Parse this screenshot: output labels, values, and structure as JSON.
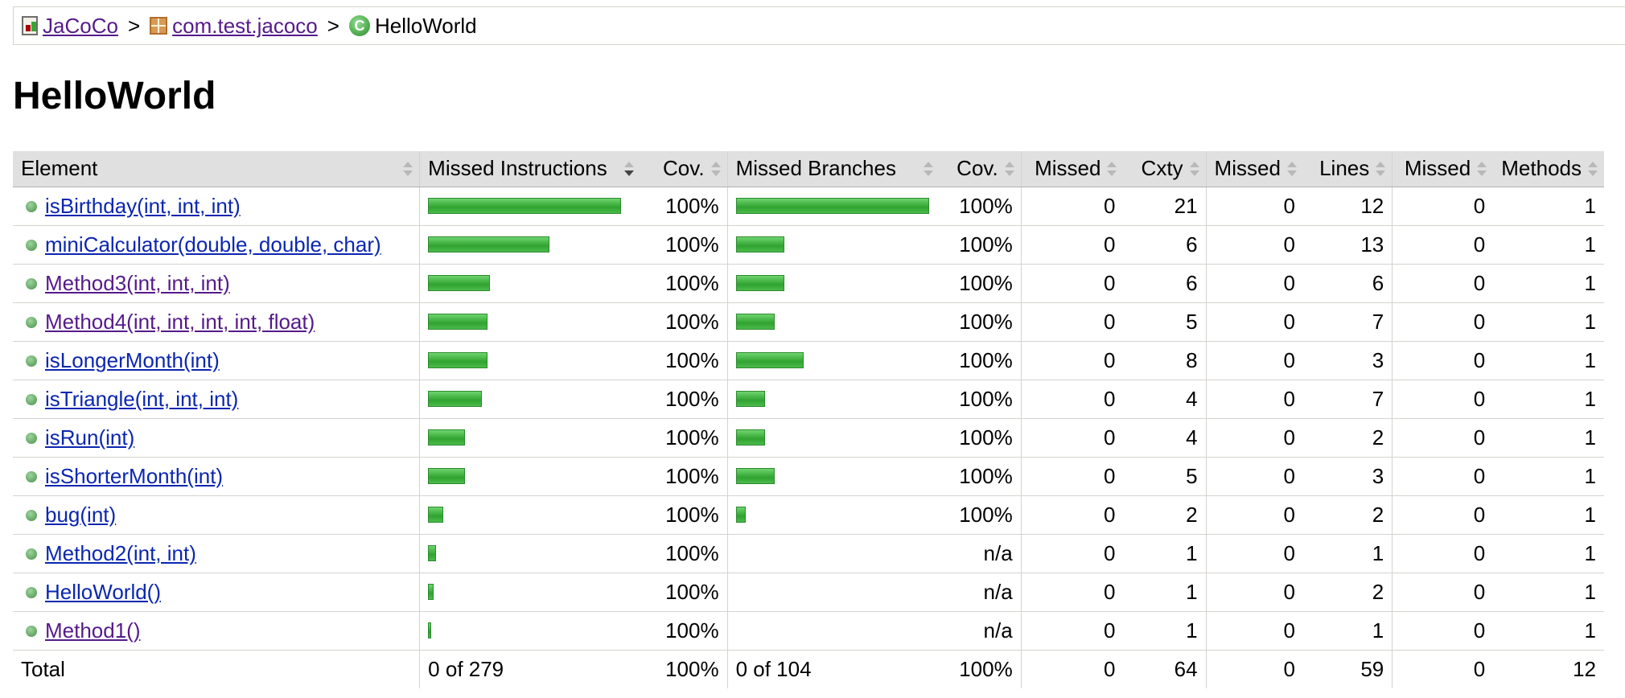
{
  "breadcrumb": {
    "root": "JaCoCo",
    "package": "com.test.jacoco",
    "current": "HelloWorld",
    "separator": ">"
  },
  "page_title": "HelloWorld",
  "table": {
    "headers": {
      "element": "Element",
      "missed_instructions": "Missed Instructions",
      "instr_cov": "Cov.",
      "missed_branches": "Missed Branches",
      "branch_cov": "Cov.",
      "missed_cxty": "Missed",
      "cxty": "Cxty",
      "missed_lines": "Missed",
      "lines": "Lines",
      "missed_methods": "Missed",
      "methods": "Methods"
    },
    "rows": [
      {
        "element": "isBirthday(int, int, int)",
        "visited": false,
        "instr_fill": 1.0,
        "instr_cov": "100%",
        "branch_fill": 1.0,
        "branch_cov": "100%",
        "missed_cxty": "0",
        "cxty": "21",
        "missed_lines": "0",
        "lines": "12",
        "missed_methods": "0",
        "methods": "1"
      },
      {
        "element": "miniCalculator(double, double, char)",
        "visited": false,
        "instr_fill": 0.63,
        "instr_cov": "100%",
        "branch_fill": 0.25,
        "branch_cov": "100%",
        "missed_cxty": "0",
        "cxty": "6",
        "missed_lines": "0",
        "lines": "13",
        "missed_methods": "0",
        "methods": "1"
      },
      {
        "element": "Method3(int, int, int)",
        "visited": true,
        "instr_fill": 0.32,
        "instr_cov": "100%",
        "branch_fill": 0.25,
        "branch_cov": "100%",
        "missed_cxty": "0",
        "cxty": "6",
        "missed_lines": "0",
        "lines": "6",
        "missed_methods": "0",
        "methods": "1"
      },
      {
        "element": "Method4(int, int, int, int, float)",
        "visited": true,
        "instr_fill": 0.31,
        "instr_cov": "100%",
        "branch_fill": 0.2,
        "branch_cov": "100%",
        "missed_cxty": "0",
        "cxty": "5",
        "missed_lines": "0",
        "lines": "7",
        "missed_methods": "0",
        "methods": "1"
      },
      {
        "element": "isLongerMonth(int)",
        "visited": false,
        "instr_fill": 0.31,
        "instr_cov": "100%",
        "branch_fill": 0.35,
        "branch_cov": "100%",
        "missed_cxty": "0",
        "cxty": "8",
        "missed_lines": "0",
        "lines": "3",
        "missed_methods": "0",
        "methods": "1"
      },
      {
        "element": "isTriangle(int, int, int)",
        "visited": false,
        "instr_fill": 0.28,
        "instr_cov": "100%",
        "branch_fill": 0.15,
        "branch_cov": "100%",
        "missed_cxty": "0",
        "cxty": "4",
        "missed_lines": "0",
        "lines": "7",
        "missed_methods": "0",
        "methods": "1"
      },
      {
        "element": "isRun(int)",
        "visited": false,
        "instr_fill": 0.19,
        "instr_cov": "100%",
        "branch_fill": 0.15,
        "branch_cov": "100%",
        "missed_cxty": "0",
        "cxty": "4",
        "missed_lines": "0",
        "lines": "2",
        "missed_methods": "0",
        "methods": "1"
      },
      {
        "element": "isShorterMonth(int)",
        "visited": false,
        "instr_fill": 0.19,
        "instr_cov": "100%",
        "branch_fill": 0.2,
        "branch_cov": "100%",
        "missed_cxty": "0",
        "cxty": "5",
        "missed_lines": "0",
        "lines": "3",
        "missed_methods": "0",
        "methods": "1"
      },
      {
        "element": "bug(int)",
        "visited": false,
        "instr_fill": 0.08,
        "instr_cov": "100%",
        "branch_fill": 0.05,
        "branch_cov": "100%",
        "missed_cxty": "0",
        "cxty": "2",
        "missed_lines": "0",
        "lines": "2",
        "missed_methods": "0",
        "methods": "1"
      },
      {
        "element": "Method2(int, int)",
        "visited": false,
        "instr_fill": 0.04,
        "instr_cov": "100%",
        "branch_fill": 0,
        "branch_cov": "n/a",
        "missed_cxty": "0",
        "cxty": "1",
        "missed_lines": "0",
        "lines": "1",
        "missed_methods": "0",
        "methods": "1"
      },
      {
        "element": "HelloWorld()",
        "visited": false,
        "instr_fill": 0.03,
        "instr_cov": "100%",
        "branch_fill": 0,
        "branch_cov": "n/a",
        "missed_cxty": "0",
        "cxty": "1",
        "missed_lines": "0",
        "lines": "2",
        "missed_methods": "0",
        "methods": "1"
      },
      {
        "element": "Method1()",
        "visited": true,
        "instr_fill": 0.015,
        "instr_cov": "100%",
        "branch_fill": 0,
        "branch_cov": "n/a",
        "missed_cxty": "0",
        "cxty": "1",
        "missed_lines": "0",
        "lines": "1",
        "missed_methods": "0",
        "methods": "1"
      }
    ],
    "total": {
      "label": "Total",
      "missed_instructions": "0 of 279",
      "instr_cov": "100%",
      "missed_branches": "0 of 104",
      "branch_cov": "100%",
      "missed_cxty": "0",
      "cxty": "64",
      "missed_lines": "0",
      "lines": "59",
      "missed_methods": "0",
      "methods": "12"
    }
  },
  "colors": {
    "bar_green": "#3cb33c",
    "link_unvisited": "#0b26b0",
    "link_visited": "#551a8b",
    "header_bg": "#e0e0e0"
  },
  "icons": {
    "report": "report-icon",
    "package": "package-icon",
    "class": "class-icon",
    "method": "method-dot-icon"
  }
}
